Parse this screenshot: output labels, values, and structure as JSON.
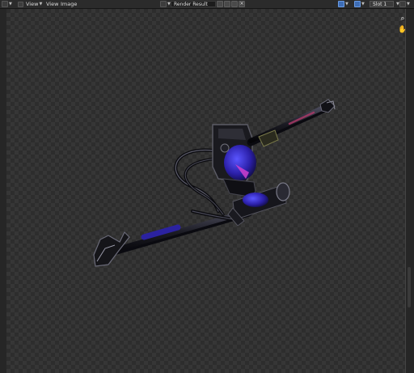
{
  "header": {
    "menu_view": "View",
    "menu_view2": "View",
    "menu_image": "Image",
    "image_name": "Render Result",
    "slot": "Slot 1"
  },
  "icons": {
    "editor_type": "image-editor-icon",
    "zoom": "zoom-icon",
    "pan": "hand-pan-icon"
  },
  "colors": {
    "header_bg": "#2b2b2b",
    "checker_dark": "#2d2d2d",
    "checker_light": "#363636",
    "accent_blue": "#3e6db5"
  }
}
